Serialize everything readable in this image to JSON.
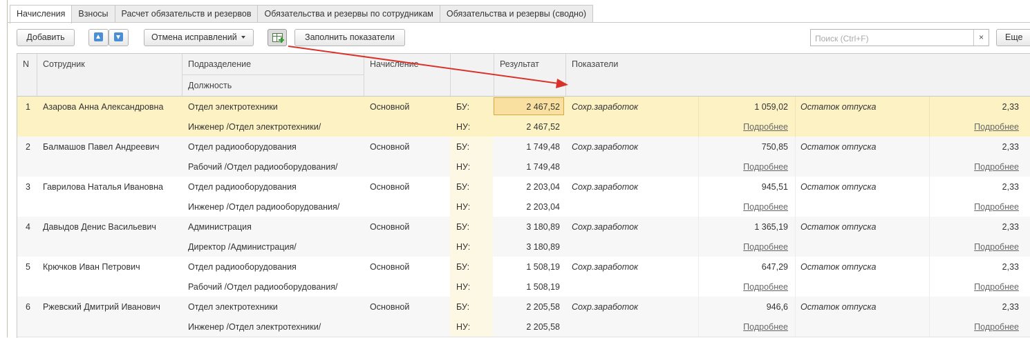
{
  "tabs": [
    "Начисления",
    "Взносы",
    "Расчет обязательств и резервов",
    "Обязательства и резервы по сотрудникам",
    "Обязательства и резервы (сводно)"
  ],
  "toolbar": {
    "add_label": "Добавить",
    "undo_label": "Отмена исправлений",
    "fill_label": "Заполнить показатели",
    "more_label": "Еще",
    "search_placeholder": "Поиск (Ctrl+F)",
    "clear_glyph": "×"
  },
  "columns": {
    "n": "N",
    "employee": "Сотрудник",
    "department": "Подразделение",
    "position": "Должность",
    "accrual": "Начисление",
    "result": "Результат",
    "indicators": "Показатели"
  },
  "rows": [
    {
      "n": "1",
      "name": "Азарова Анна Александровна",
      "dept": "Отдел электротехники",
      "pos": "Инженер /Отдел электротехники/",
      "accrual": "Основной",
      "bu_label": "БУ:",
      "nu_label": "НУ:",
      "bu": "2 467,52",
      "nu": "2 467,52",
      "ind1_name": "Сохр.заработок",
      "ind1_value": "1 059,02",
      "ind2_name": "Остаток отпуска",
      "ind2_value": "2,33",
      "link1": "Подробнее",
      "link2": "Подробнее"
    },
    {
      "n": "2",
      "name": "Балмашов Павел Андреевич",
      "dept": "Отдел радиооборудования",
      "pos": "Рабочий /Отдел радиооборудования/",
      "accrual": "Основной",
      "bu_label": "БУ:",
      "nu_label": "НУ:",
      "bu": "1 749,48",
      "nu": "1 749,48",
      "ind1_name": "Сохр.заработок",
      "ind1_value": "750,85",
      "ind2_name": "Остаток отпуска",
      "ind2_value": "2,33",
      "link1": "Подробнее",
      "link2": "Подробнее"
    },
    {
      "n": "3",
      "name": "Гаврилова Наталья Ивановна",
      "dept": "Отдел радиооборудования",
      "pos": "Инженер /Отдел радиооборудования/",
      "accrual": "Основной",
      "bu_label": "БУ:",
      "nu_label": "НУ:",
      "bu": "2 203,04",
      "nu": "2 203,04",
      "ind1_name": "Сохр.заработок",
      "ind1_value": "945,51",
      "ind2_name": "Остаток отпуска",
      "ind2_value": "2,33",
      "link1": "Подробнее",
      "link2": "Подробнее"
    },
    {
      "n": "4",
      "name": "Давыдов Денис Васильевич",
      "dept": "Администрация",
      "pos": "Директор /Администрация/",
      "accrual": "Основной",
      "bu_label": "БУ:",
      "nu_label": "НУ:",
      "bu": "3 180,89",
      "nu": "3 180,89",
      "ind1_name": "Сохр.заработок",
      "ind1_value": "1 365,19",
      "ind2_name": "Остаток отпуска",
      "ind2_value": "2,33",
      "link1": "Подробнее",
      "link2": "Подробнее"
    },
    {
      "n": "5",
      "name": "Крючков Иван Петрович",
      "dept": "Отдел радиооборудования",
      "pos": "Рабочий /Отдел радиооборудования/",
      "accrual": "Основной",
      "bu_label": "БУ:",
      "nu_label": "НУ:",
      "bu": "1 508,19",
      "nu": "1 508,19",
      "ind1_name": "Сохр.заработок",
      "ind1_value": "647,29",
      "ind2_name": "Остаток отпуска",
      "ind2_value": "2,33",
      "link1": "Подробнее",
      "link2": "Подробнее"
    },
    {
      "n": "6",
      "name": "Ржевский Дмитрий Иванович",
      "dept": "Отдел электротехники",
      "pos": "Инженер /Отдел электротехники/",
      "accrual": "Основной",
      "bu_label": "БУ:",
      "nu_label": "НУ:",
      "bu": "2 205,58",
      "nu": "2 205,58",
      "ind1_name": "Сохр.заработок",
      "ind1_value": "946,6",
      "ind2_name": "Остаток отпуска",
      "ind2_value": "2,33",
      "link1": "Подробнее",
      "link2": "Подробнее"
    }
  ],
  "colors": {
    "selected_row": "#fdf2c4",
    "active_cell": "#f9dfa0",
    "annotation_arrow": "#d9322b",
    "arrow_button": "#4a8fd6"
  },
  "icons": [
    "arrow-up-icon",
    "arrow-down-icon",
    "dropdown-caret-icon",
    "add-table-icon",
    "clear-icon",
    "annotation-arrow"
  ]
}
